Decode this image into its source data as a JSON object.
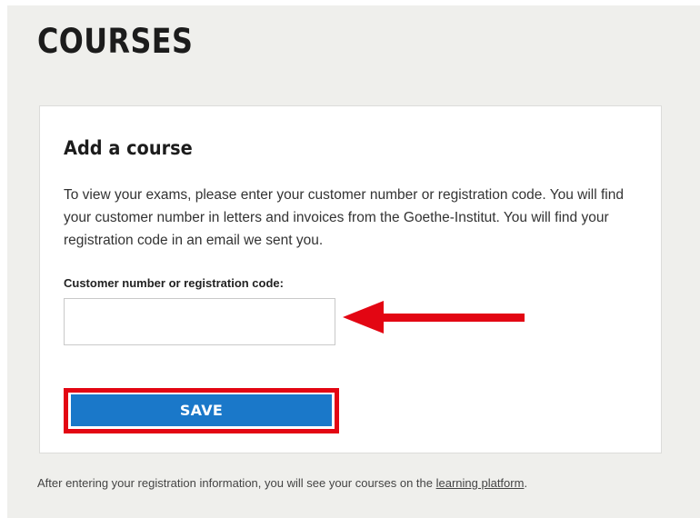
{
  "header": {
    "title": "COURSES"
  },
  "card": {
    "title": "Add a course",
    "description": "To view your exams, please enter your customer number or registration code. You will find your customer number in letters and invoices from the Goethe-Institut. You will find your registration code in an email we sent you.",
    "field": {
      "label": "Customer number or registration code:",
      "value": "",
      "placeholder": ""
    },
    "save_label": "SAVE"
  },
  "footer": {
    "text_before": "After entering your registration information, you will see your courses on the ",
    "link_text": "learning platform",
    "text_after": "."
  },
  "annotations": {
    "arrow_color": "#e30613",
    "highlight_color": "#e30613",
    "button_color": "#1a78c9"
  }
}
